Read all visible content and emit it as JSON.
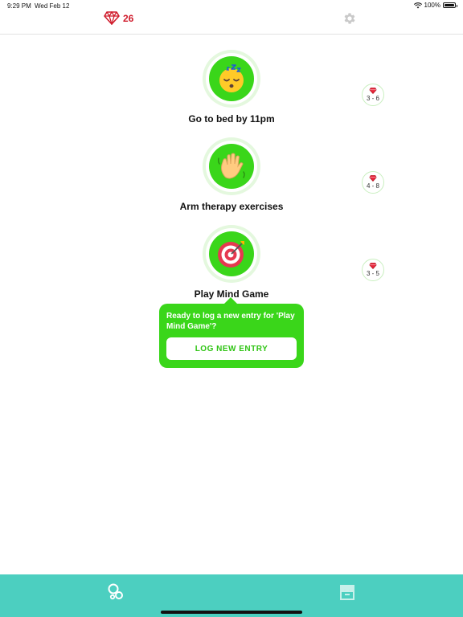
{
  "status_bar": {
    "time": "9:29 PM",
    "date": "Wed Feb 12",
    "battery": "100%"
  },
  "header": {
    "gem_count": "26",
    "gem_color": "#d01c2c"
  },
  "habits": [
    {
      "title": "Go to bed by 11pm",
      "icon": "sleeping-face-icon",
      "reward_range": "3 - 6"
    },
    {
      "title": "Arm therapy exercises",
      "icon": "waving-hand-icon",
      "reward_range": "4 - 8"
    },
    {
      "title": "Play Mind Game",
      "icon": "target-icon",
      "reward_range": "3 - 5"
    }
  ],
  "popover": {
    "message": "Ready to log a new entry for 'Play Mind Game'?",
    "button_label": "LOG NEW ENTRY"
  },
  "tab_bar": {
    "tabs": [
      "habits-tab-icon",
      "store-tab-icon"
    ]
  },
  "colors": {
    "accent_green": "#3ad61a",
    "tab_bar": "#4ccfc0",
    "gem_red": "#d01c2c"
  }
}
